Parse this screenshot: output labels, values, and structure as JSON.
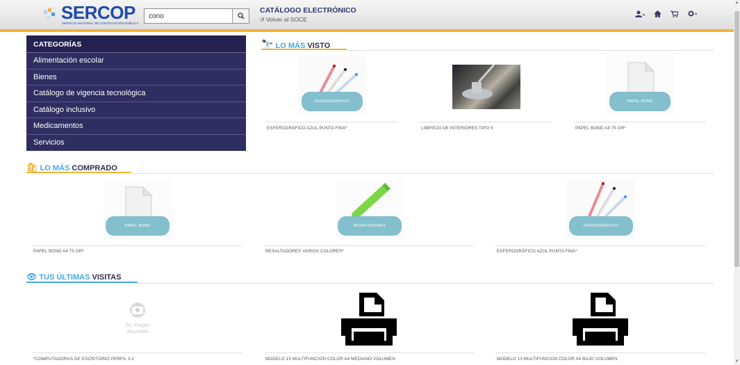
{
  "header": {
    "logo_text": "SERCOP",
    "logo_subtitle": "SERVICIO NACIONAL DE CONTRATACIÓN PÚBLICA",
    "search_value": "cono",
    "catalog_title": "CATÁLOGO ELECTRÓNICO",
    "back_link": "Volver al SOCE"
  },
  "sidebar": {
    "title": "CATEGORÍAS",
    "items": [
      {
        "label": "Alimentación escolar"
      },
      {
        "label": "Bienes"
      },
      {
        "label": "Catálogo de vigencia tecnológica"
      },
      {
        "label": "Catálogo inclusivo"
      },
      {
        "label": "Medicamentos"
      },
      {
        "label": "Servicios"
      }
    ]
  },
  "sections": {
    "most_viewed": {
      "light": "LO MÁS",
      "dark": "VISTO"
    },
    "most_bought": {
      "light": "LO MÁS",
      "dark": "COMPRADO"
    },
    "recent": {
      "light": "TUS ÚLTIMAS",
      "dark": "VISITAS"
    }
  },
  "products": {
    "viewed": [
      {
        "name": "ESFEROGRÁFICO AZUL PUNTA FINA*",
        "badge": "ESFEROGRÁFICO"
      },
      {
        "name": "LIMPIEZA DE INTERIORES TIPO II"
      },
      {
        "name": "PAPEL BOND A4 75 GR*",
        "badge": "PAPEL BOND"
      }
    ],
    "bought": [
      {
        "name": "PAPEL BOND A4 75 GR*",
        "badge": "PAPEL BOND"
      },
      {
        "name": "RESALTADORES VARIOS COLORES*",
        "badge": "RESALTADORES"
      },
      {
        "name": "ESFEROGRÁFICO AZUL PUNTA FINA*",
        "badge": "ESFEROGRÁFICO"
      }
    ],
    "recent": [
      {
        "name": "*COMPUTADORAS DE ESCRITORIO PERFIL 3.2",
        "no_image": "Sin Imagen disponible"
      },
      {
        "name": "MODELO 15 MULTIFUNCION COLOR A4 MEDIANO VOLUMEN"
      },
      {
        "name": "MODELO 13 MULTIFUNCION COLOR A4 BAJO VOLUMEN"
      }
    ]
  },
  "colors": {
    "accent": "#f5b335",
    "sidebar": "#2f2d61",
    "blue": "#43a9e1"
  }
}
